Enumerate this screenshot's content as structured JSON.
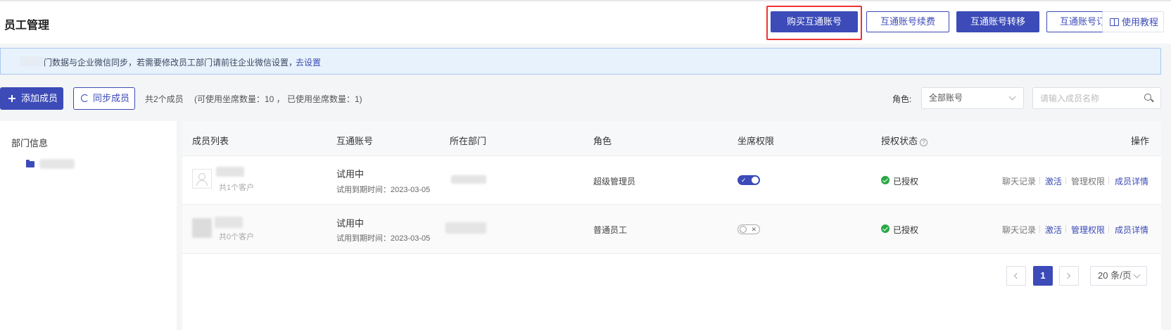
{
  "header": {
    "title": "员工管理",
    "buttons": {
      "buy": "购买互通账号",
      "renew": "互通账号续费",
      "transfer": "互通账号转移",
      "orders": "互通账号订单",
      "tutorial": "使用教程"
    }
  },
  "notice": {
    "text": "门数据与企业微信同步，若需要修改员工部门请前往企业微信设置，",
    "link": "去设置"
  },
  "toolbar": {
    "add_member": "添加成员",
    "sync_member": "同步成员",
    "member_count": "共2个成员",
    "seat_info": "(可使用坐席数量：10 ， 已使用坐席数量：1)",
    "role_label": "角色:",
    "role_value": "全部账号",
    "search_placeholder": "请输入成员名称"
  },
  "dept_panel": {
    "title": "部门信息"
  },
  "table": {
    "columns": [
      "成员列表",
      "互通账号",
      "所在部门",
      "角色",
      "坐席权限",
      "授权状态",
      "操作"
    ],
    "rows": [
      {
        "customer_count": "共1个客户",
        "account_status": "试用中",
        "expire": "试用到期时间：2023-03-05",
        "role": "超级管理员",
        "seat_enabled": true,
        "auth_status": "已授权",
        "actions": [
          "聊天记录",
          "激活",
          "管理权限",
          "成员详情"
        ]
      },
      {
        "customer_count": "共0个客户",
        "account_status": "试用中",
        "expire": "试用到期时间：2023-03-05",
        "role": "普通员工",
        "seat_enabled": false,
        "auth_status": "已授权",
        "actions": [
          "聊天记录",
          "激活",
          "管理权限",
          "成员详情"
        ]
      }
    ]
  },
  "pagination": {
    "current_page": "1",
    "page_size": "20 条/页"
  },
  "icons": {
    "tutorial": "book-icon",
    "add": "plus-icon",
    "sync": "refresh-icon",
    "search": "search-icon",
    "dept": "folder-icon",
    "help": "question-circle-icon",
    "authorized": "check-circle-icon"
  },
  "colors": {
    "primary": "#3c4bb8",
    "highlight_box": "#ee3333",
    "success": "#27a844",
    "notice_bg": "#e8f2fc"
  }
}
